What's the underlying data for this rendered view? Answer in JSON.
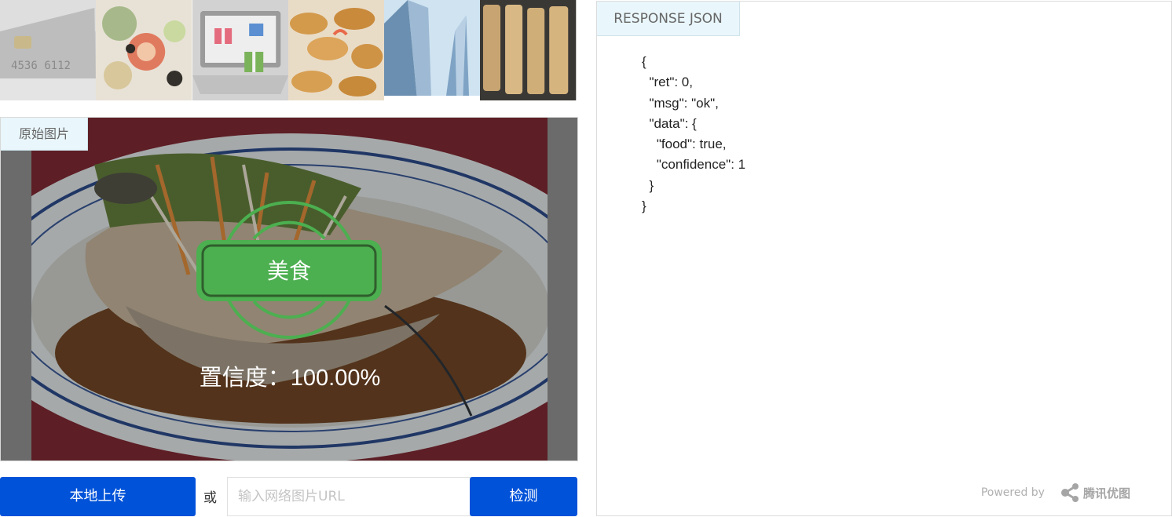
{
  "thumbnails": [
    {
      "name": "credit-card-thumb"
    },
    {
      "name": "appetizer-thumb"
    },
    {
      "name": "gift-laptop-thumb"
    },
    {
      "name": "fried-rolls-thumb"
    },
    {
      "name": "skyscraper-thumb"
    },
    {
      "name": "fried-pork-thumb"
    }
  ],
  "original": {
    "tab_label": "原始图片",
    "result_label": "美食",
    "confidence_prefix": "置信度：",
    "confidence_value": "100.00%"
  },
  "controls": {
    "upload_label": "本地上传",
    "or_label": "或",
    "url_placeholder": "输入网络图片URL",
    "detect_label": "检测"
  },
  "response": {
    "tab_label": "RESPONSE JSON",
    "json_text": "{\n  \"ret\": 0,\n  \"msg\": \"ok\",\n  \"data\": {\n    \"food\": true,\n    \"confidence\": 1\n  }\n}",
    "powered_by": "Powered by",
    "brand": "腾讯优图"
  },
  "colors": {
    "primary_button": "#0052d9",
    "tab_background": "#e9f6fb",
    "badge_green": "#4caf50"
  }
}
